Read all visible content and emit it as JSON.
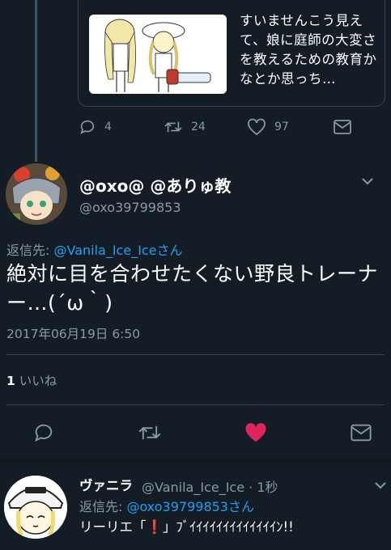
{
  "quoted": {
    "text": "すいませんこう見えて、娘に庭師の大変さを教えるための教育かなとか思っち…",
    "replies": "4",
    "retweets": "24",
    "likes": "97"
  },
  "tweet": {
    "display_name": "@oxo@ @ありゅ教",
    "screen_name": "@oxo39799853",
    "reply_prefix": "返信先: ",
    "reply_to": "@Vanila_Ice_Iceさん",
    "text": "絶対に目を合わせたくない野良トレーナー…(´ω｀)",
    "timestamp": "2017年06月19日 6:50",
    "likes_count": "1",
    "likes_label": "いいね"
  },
  "reply": {
    "display_name": "ヴァニラ",
    "handle_time": "@Vanila_Ice_Ice · 1秒",
    "reply_prefix": "返信先: ",
    "reply_to": "@oxo39799853さん",
    "text_before": "リーリエ「",
    "exclaim": "❗",
    "text_after": "」ﾌﾞｲｲｲｲｲｲｲｲｲｲｲｲｲﾝ!!"
  },
  "colors": {
    "background": "#141d26",
    "secondary_text": "#8899a6",
    "link": "#1da1f2",
    "like_active": "#e0245e"
  },
  "icons": [
    "reply-icon",
    "retweet-icon",
    "heart-icon",
    "dm-icon",
    "chevron-down-icon"
  ]
}
